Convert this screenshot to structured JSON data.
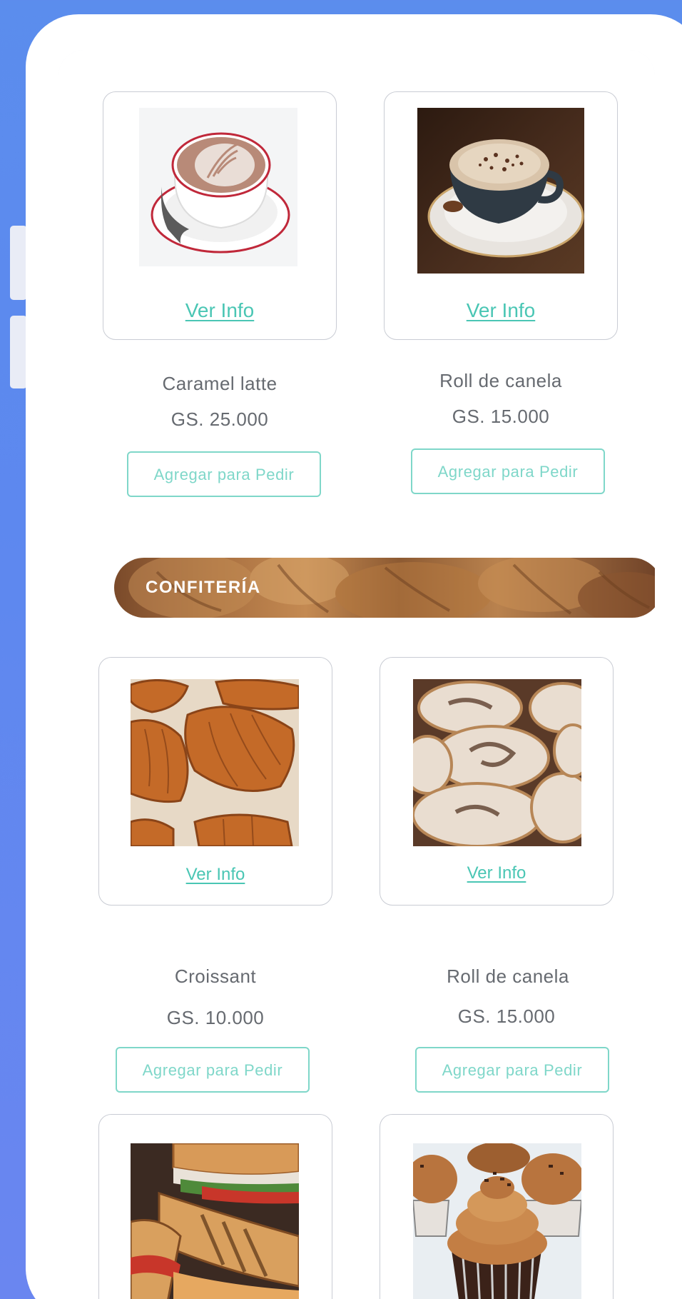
{
  "section": {
    "title": "CONFITERÍA"
  },
  "products_top": [
    {
      "name": "Caramel latte",
      "price": "GS. 25.000",
      "info_label": "Ver Info",
      "add_label": "Agregar para Pedir"
    },
    {
      "name": "Roll de canela",
      "price": "GS. 15.000",
      "info_label": "Ver Info",
      "add_label": "Agregar para Pedir"
    }
  ],
  "products_confiteria": [
    {
      "name": "Croissant",
      "price": "GS. 10.000",
      "info_label": "Ver Info",
      "add_label": "Agregar para Pedir"
    },
    {
      "name": "Roll de canela",
      "price": "GS. 15.000",
      "info_label": "Ver Info",
      "add_label": "Agregar para Pedir"
    }
  ],
  "colors": {
    "background": "#5b8ded",
    "accent_teal": "#4ac6b4",
    "button_border": "#7fd7c9",
    "text_gray": "#666a70"
  }
}
